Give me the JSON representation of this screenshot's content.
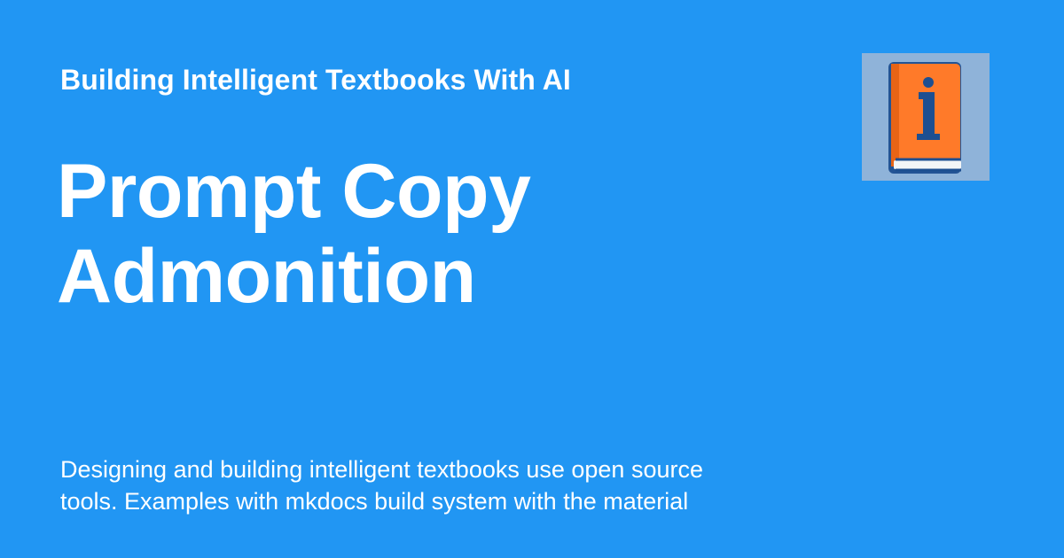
{
  "site": {
    "title": "Building Intelligent Textbooks With AI"
  },
  "page": {
    "title": "Prompt Copy Admonition",
    "description": "Designing and building intelligent textbooks use open source\ntools.  Examples with mkdocs build system with the material"
  },
  "logo": {
    "icon": "info-book-icon"
  },
  "colors": {
    "background": "#2196f3",
    "logo_background": "#8fb3d9",
    "book_cover": "#ff7a29",
    "book_outline": "#1d4f91"
  }
}
